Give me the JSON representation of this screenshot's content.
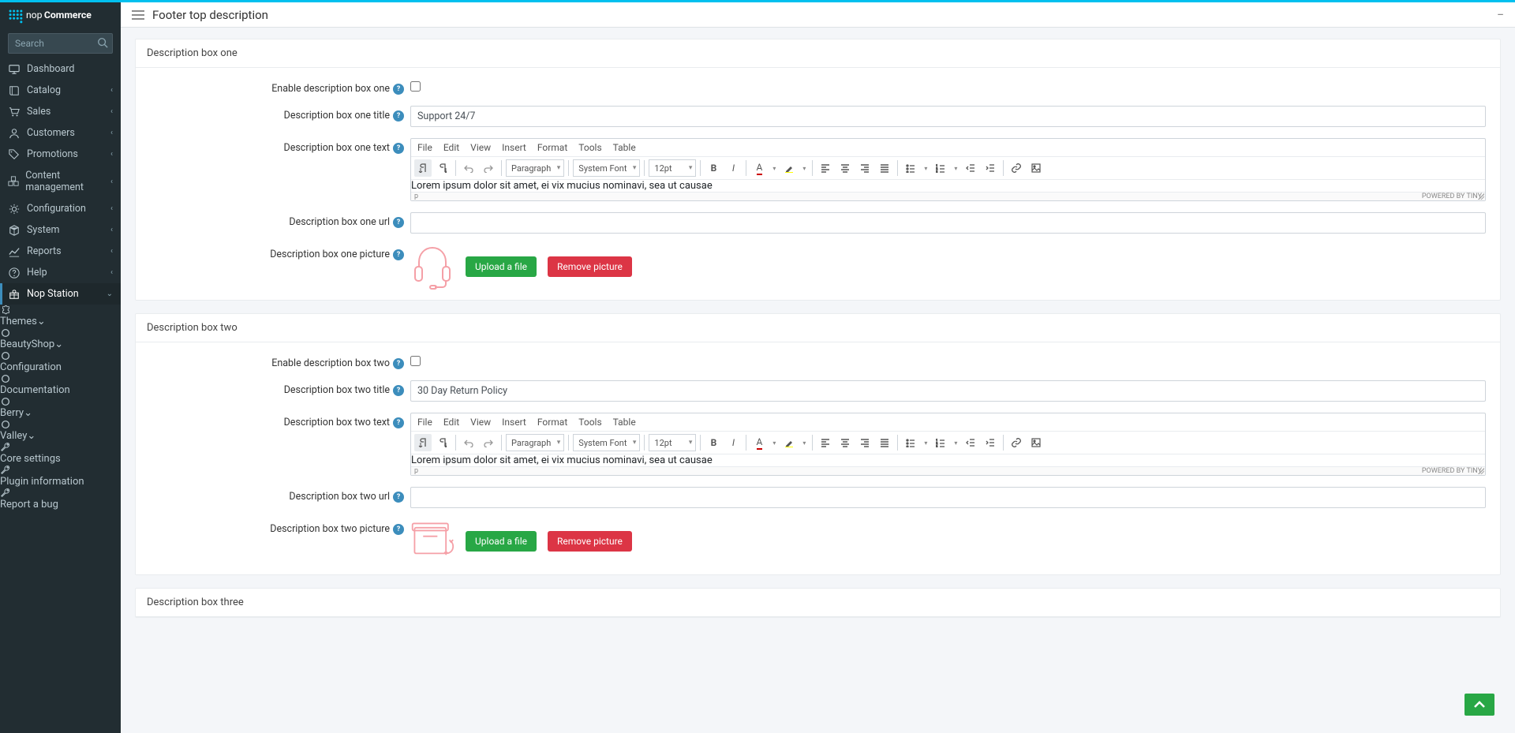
{
  "brand": "nopCommerce",
  "search": {
    "placeholder": "Search"
  },
  "sidebar": {
    "items": [
      {
        "label": "Dashboard",
        "icon": "desktop"
      },
      {
        "label": "Catalog",
        "icon": "book",
        "expandable": true
      },
      {
        "label": "Sales",
        "icon": "cart",
        "expandable": true
      },
      {
        "label": "Customers",
        "icon": "user",
        "expandable": true
      },
      {
        "label": "Promotions",
        "icon": "tags",
        "expandable": true
      },
      {
        "label": "Content management",
        "icon": "cubes",
        "expandable": true
      },
      {
        "label": "Configuration",
        "icon": "cogs",
        "expandable": true
      },
      {
        "label": "System",
        "icon": "cube",
        "expandable": true
      },
      {
        "label": "Reports",
        "icon": "chart",
        "expandable": true
      },
      {
        "label": "Help",
        "icon": "question",
        "expandable": true
      },
      {
        "label": "Nop Station",
        "icon": "gift",
        "expandable": true,
        "active": true
      }
    ],
    "sub": [
      {
        "label": "Themes",
        "icon": "puzzle",
        "expandable": true
      },
      {
        "label": "BeautyShop",
        "icon": "circle",
        "expandable": true
      },
      {
        "label": "Configuration",
        "icon": "circle"
      },
      {
        "label": "Documentation",
        "icon": "circle"
      },
      {
        "label": "Berry",
        "icon": "circle",
        "expandable": true
      },
      {
        "label": "Valley",
        "icon": "circle",
        "expandable": true
      },
      {
        "label": "Core settings",
        "icon": "wrench"
      },
      {
        "label": "Plugin information",
        "icon": "wrench"
      },
      {
        "label": "Report a bug",
        "icon": "wrench"
      }
    ]
  },
  "header": {
    "title": "Footer top description"
  },
  "sections": [
    {
      "key": "one",
      "title": "Description box one",
      "enable_label": "Enable description box one",
      "title_label": "Description box one title",
      "title_value": "Support 24/7",
      "text_label": "Description box one text",
      "text_value": "Lorem ipsum dolor sit amet, ei vix mucius nominavi, sea ut causae",
      "url_label": "Description box one url",
      "url_value": "",
      "picture_label": "Description box one picture",
      "pic_type": "headphones"
    },
    {
      "key": "two",
      "title": "Description box two",
      "enable_label": "Enable description box two",
      "title_label": "Description box two title",
      "title_value": "30 Day Return Policy",
      "text_label": "Description box two text",
      "text_value": "Lorem ipsum dolor sit amet, ei vix mucius nominavi, sea ut causae",
      "url_label": "Description box two url",
      "url_value": "",
      "picture_label": "Description box two picture",
      "pic_type": "returnbox"
    },
    {
      "key": "three",
      "title": "Description box three"
    }
  ],
  "editor": {
    "menus": [
      "File",
      "Edit",
      "View",
      "Insert",
      "Format",
      "Tools",
      "Table"
    ],
    "paragraph": "Paragraph",
    "font": "System Font",
    "size": "12pt",
    "status_path": "p",
    "powered": "POWERED BY TINY"
  },
  "buttons": {
    "upload": "Upload a file",
    "remove": "Remove picture"
  }
}
